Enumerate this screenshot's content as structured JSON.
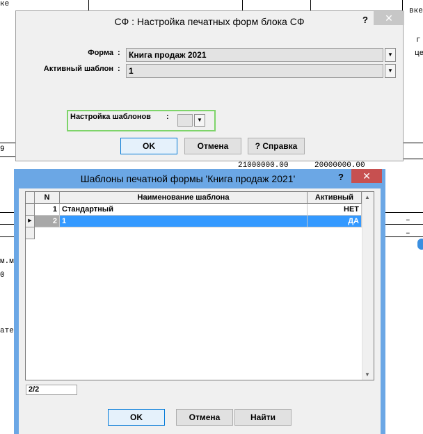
{
  "background": {
    "texts": [
      "ке",
      "вке",
      "г",
      "це",
      "9",
      "21000000.00",
      "20000000.00",
      "–",
      "–",
      "–",
      "м.м.",
      "0",
      "ате"
    ]
  },
  "settings_dialog": {
    "title": "СФ : Настройка печатных форм блока СФ",
    "help_label": "?",
    "close_label": "✕",
    "form_label": "Форма",
    "form_value": "Книга продаж 2021",
    "active_template_label": "Активный шаблон",
    "active_template_value": "1",
    "colon": ":",
    "templates_setup_label": "Настройка шаблонов",
    "highlight_color": "#7ed46a",
    "ok_label": "OK",
    "cancel_label": "Отмена",
    "help_button_label": "? Справка"
  },
  "templates_dialog": {
    "title": "Шаблоны печатной формы 'Книга продаж 2021'",
    "help_label": "?",
    "close_label": "✕",
    "accent_color": "#6ba7e5",
    "columns": [
      "N",
      "Наименование шаблона",
      "Активный"
    ],
    "rows": [
      {
        "n": "1",
        "name": "Стандартный",
        "active": "НЕТ"
      },
      {
        "n": "2",
        "name": "1",
        "active": "ДА"
      }
    ],
    "record_counter": "2/2",
    "ok_label": "OK",
    "cancel_label": "Отмена",
    "find_label": "Найти"
  }
}
